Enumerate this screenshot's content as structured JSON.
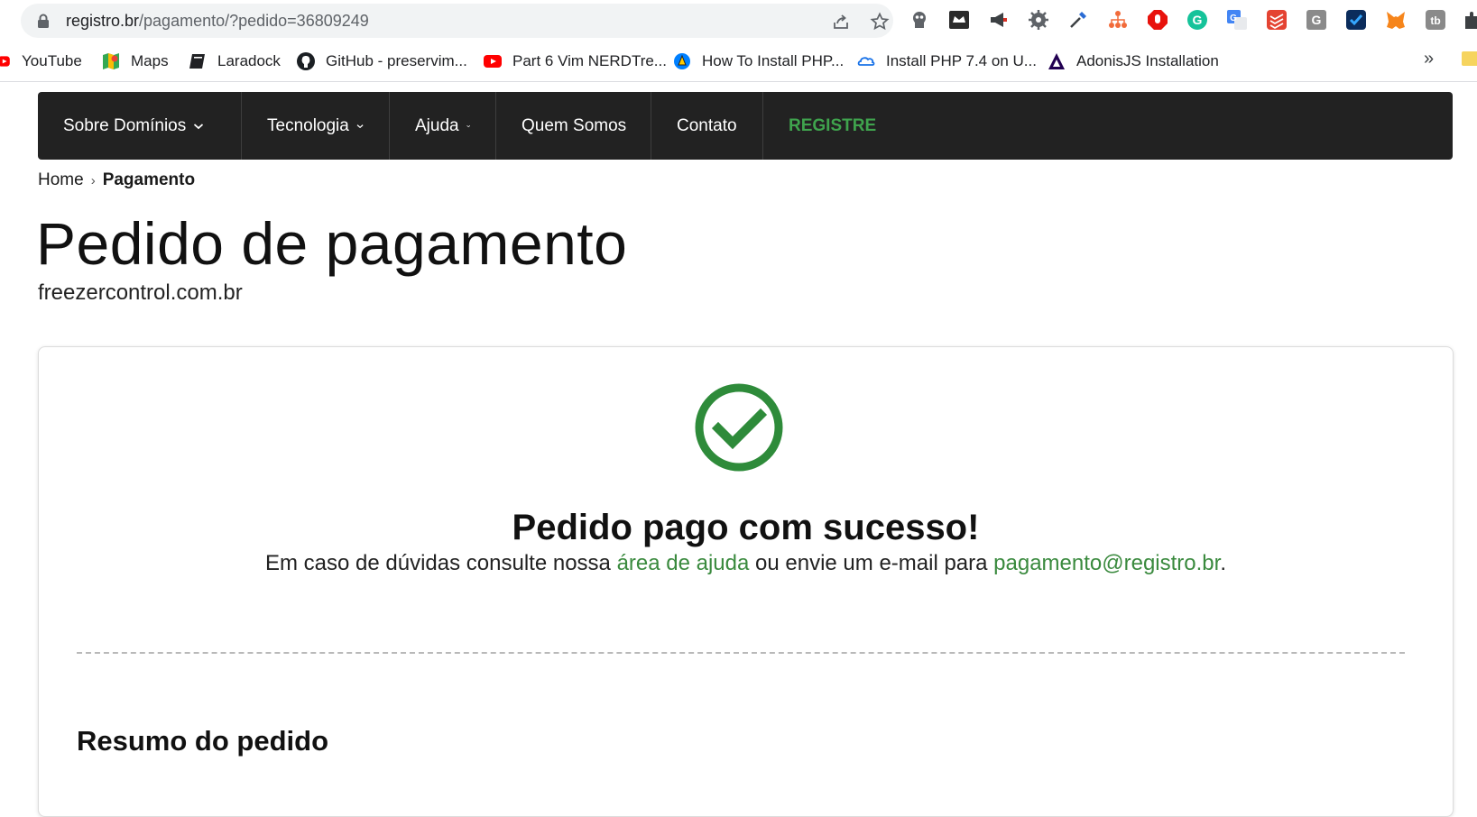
{
  "browser": {
    "url_host": "registro.br",
    "url_path": "/pagamento/?pedido=36809249"
  },
  "bookmarks": [
    {
      "label": "YouTube",
      "icon": "youtube-icon"
    },
    {
      "label": "Maps",
      "icon": "maps-icon"
    },
    {
      "label": "Laradock",
      "icon": "book-icon"
    },
    {
      "label": "GitHub - preservim...",
      "icon": "github-icon"
    },
    {
      "label": "Part 6 Vim NERDTre...",
      "icon": "youtube-icon"
    },
    {
      "label": "How To Install PHP...",
      "icon": "digitalocean-icon"
    },
    {
      "label": "Install PHP 7.4 on U...",
      "icon": "cloud-icon"
    },
    {
      "label": "AdonisJS Installation",
      "icon": "adonis-icon"
    }
  ],
  "bookmarks_more": "»",
  "nav": {
    "items": [
      {
        "label": "Sobre Domínios"
      },
      {
        "label": "Tecnologia"
      },
      {
        "label": "Ajuda"
      },
      {
        "label": "Quem Somos"
      },
      {
        "label": "Contato"
      },
      {
        "label": "REGISTRE"
      }
    ]
  },
  "breadcrumb": {
    "home": "Home",
    "separator": "›",
    "current": "Pagamento"
  },
  "page": {
    "title": "Pedido de pagamento",
    "domain": "freezercontrol.com.br"
  },
  "card": {
    "success_title": "Pedido pago com sucesso!",
    "help_prefix": "Em caso de dúvidas consulte nossa ",
    "help_link": "área de ajuda",
    "help_middle": " ou envie um e-mail para ",
    "help_email": "pagamento@registro.br",
    "help_suffix": ".",
    "summary_title": "Resumo do pedido"
  },
  "colors": {
    "nav_bg": "#222222",
    "accent_green": "#3fa34d",
    "check_green": "#2e8b3a",
    "link_green": "#3a8a3e"
  }
}
